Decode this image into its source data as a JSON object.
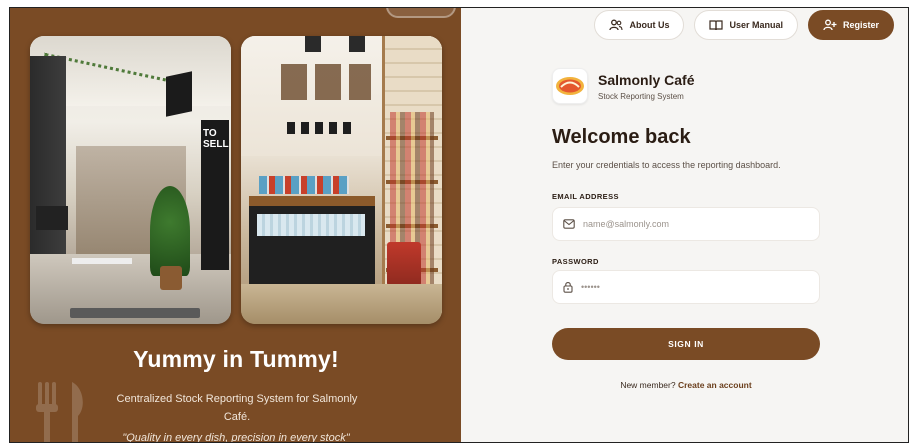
{
  "left": {
    "title": "Yummy in Tummy!",
    "subtitle": "Centralized Stock Reporting System for Salmonly Café.",
    "quote": "\"Quality in every dish, precision in every stock\"",
    "photo1_sign_text": "TO SELL"
  },
  "nav": {
    "about_label": "About Us",
    "about_icon": "users-icon",
    "manual_label": "User Manual",
    "manual_icon": "book-icon",
    "register_label": "Register",
    "register_icon": "user-plus-icon"
  },
  "brand": {
    "name": "Salmonly Café",
    "subtitle": "Stock Reporting System",
    "logo_icon": "salmonly-logo"
  },
  "form": {
    "heading": "Welcome back",
    "subheading": "Enter your credentials to access the reporting dashboard.",
    "email_label": "EMAIL ADDRESS",
    "email_placeholder": "name@salmonly.com",
    "password_label": "PASSWORD",
    "password_placeholder": "••••••",
    "signin_label": "SIGN IN",
    "new_member_text": "New member?",
    "create_account_label": "Create an account"
  },
  "colors": {
    "brand_brown": "#7a4b25",
    "panel_bg": "#f6f5f3"
  }
}
